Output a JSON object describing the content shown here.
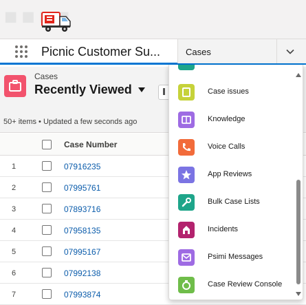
{
  "header": {
    "logo_icon": "delivery-truck-icon"
  },
  "nav": {
    "app_launcher_icon": "app-launcher-waffle-icon",
    "app_name": "Picnic Customer Su...",
    "tab_label": "Cases",
    "tab_chevron_icon": "chevron-down-icon"
  },
  "list": {
    "object_label": "Cases",
    "object_icon": "case-icon",
    "object_color": "#f2536d",
    "view_title": "Recently Viewed",
    "meta": "50+ items • Updated a few seconds ago",
    "column_header": "Case Number",
    "rows": [
      {
        "num": "1",
        "case_number": "07916235"
      },
      {
        "num": "2",
        "case_number": "07995761"
      },
      {
        "num": "3",
        "case_number": "07893716"
      },
      {
        "num": "4",
        "case_number": "07958135"
      },
      {
        "num": "5",
        "case_number": "07995167"
      },
      {
        "num": "6",
        "case_number": "07992138"
      },
      {
        "num": "7",
        "case_number": "07993874"
      }
    ]
  },
  "dropdown": {
    "items": [
      {
        "label": "Case issues",
        "icon": "case-issues-icon",
        "color": "#c6d23a"
      },
      {
        "label": "Knowledge",
        "icon": "knowledge-icon",
        "color": "#9e6be3"
      },
      {
        "label": "Voice Calls",
        "icon": "phone-icon",
        "color": "#f26b3a"
      },
      {
        "label": "App Reviews",
        "icon": "star-icon",
        "color": "#7b74e3"
      },
      {
        "label": "Bulk Case Lists",
        "icon": "wrench-icon",
        "color": "#1ea58a"
      },
      {
        "label": "Incidents",
        "icon": "incident-icon",
        "color": "#b3236e"
      },
      {
        "label": "Psimi Messages",
        "icon": "message-icon",
        "color": "#9e6be3"
      },
      {
        "label": "Case Review Console",
        "icon": "console-icon",
        "color": "#6fbd4a"
      }
    ],
    "partial_top_icon_color": "#1ea58a"
  }
}
